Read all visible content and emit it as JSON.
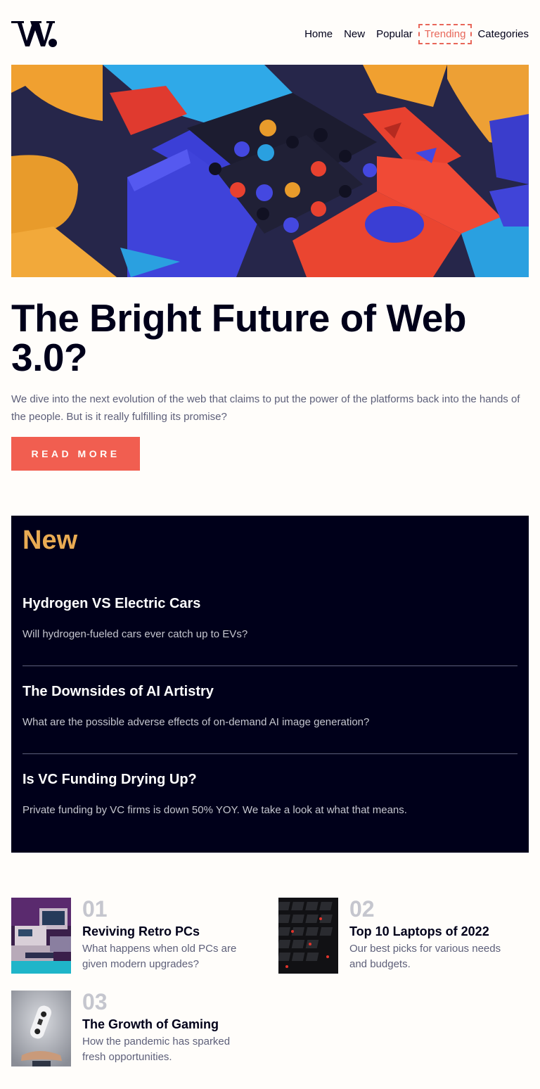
{
  "header": {
    "logo_text": "W.",
    "nav": [
      {
        "label": "Home"
      },
      {
        "label": "New"
      },
      {
        "label": "Popular"
      },
      {
        "label": "Trending"
      },
      {
        "label": "Categories"
      }
    ]
  },
  "hero": {
    "title": "The Bright Future of Web 3.0?",
    "description": "We dive into the next evolution of the web that claims to put the power of the platforms back into the hands of the people. But is it really fulfilling its promise?",
    "button_label": "READ MORE"
  },
  "new_section": {
    "heading": "New",
    "items": [
      {
        "title": "Hydrogen VS Electric Cars",
        "description": "Will hydrogen-fueled cars ever catch up to EVs?"
      },
      {
        "title": "The Downsides of AI Artistry",
        "description": "What are the possible adverse effects of on-demand AI image generation?"
      },
      {
        "title": "Is VC Funding Drying Up?",
        "description": "Private funding by VC firms is down 50% YOY. We take a look at what that means."
      }
    ]
  },
  "featured": [
    {
      "number": "01",
      "title": "Reviving Retro PCs",
      "description": "What happens when old PCs are given modern upgrades?"
    },
    {
      "number": "02",
      "title": "Top 10 Laptops of 2022",
      "description": "Our best picks for various needs and budgets."
    },
    {
      "number": "03",
      "title": "The Growth of Gaming",
      "description": "How the pandemic has sparked fresh opportunities."
    }
  ],
  "colors": {
    "accent": "#f15e50",
    "dark": "#00001a",
    "gold": "#e9ab53",
    "muted": "#5d5f79",
    "light_gray": "#c5c6ce",
    "background": "#fffdfa"
  }
}
